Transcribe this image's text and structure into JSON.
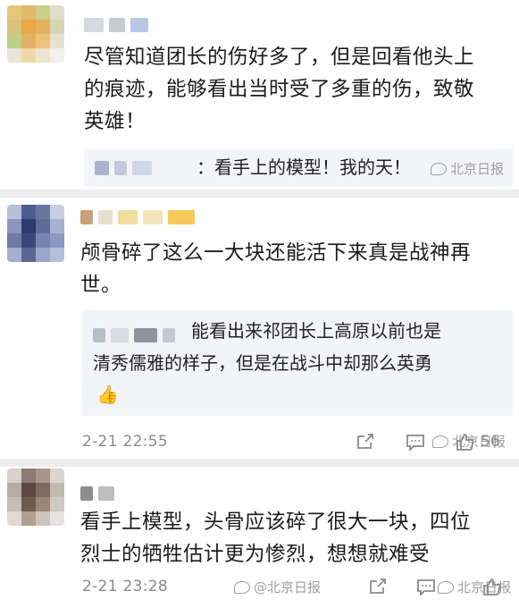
{
  "comments": [
    {
      "text_line1": "尽管知道团长的伤好多了，但是回看他头上",
      "text_line2": "的痕迹，能够看出当时受了多重的伤，致敬",
      "text_line3": "英雄！",
      "reply_text": "：看手上的模型！我的天！",
      "watermark": "北京日报"
    },
    {
      "text_line1": "颅骨碎了这么一大块还能活下来真是战神再",
      "text_line2": "世。",
      "quote_line1": "能看出来祁团长上高原以前也是",
      "quote_line2": "清秀儒雅的样子，但是在战斗中却那么英勇",
      "quote_emoji": "👍",
      "time": "2-21 22:55",
      "watermark": "北京日报",
      "like_count": "56"
    },
    {
      "text_line1": "看手上模型，头骨应该碎了很大一块，四位",
      "text_line2": "烈士的牺牲估计更为惨烈，想想就难受",
      "time": "2-21 23:28",
      "bottom_watermark": "@北京日报",
      "watermark": "北京日报"
    }
  ],
  "colors": {
    "separator": "#eeeeee",
    "quote_bg": "#f3f4f7",
    "meta_text": "#8a8a8a"
  },
  "icons": [
    "share-icon",
    "comment-icon",
    "like-icon",
    "wechat-watermark-icon"
  ]
}
